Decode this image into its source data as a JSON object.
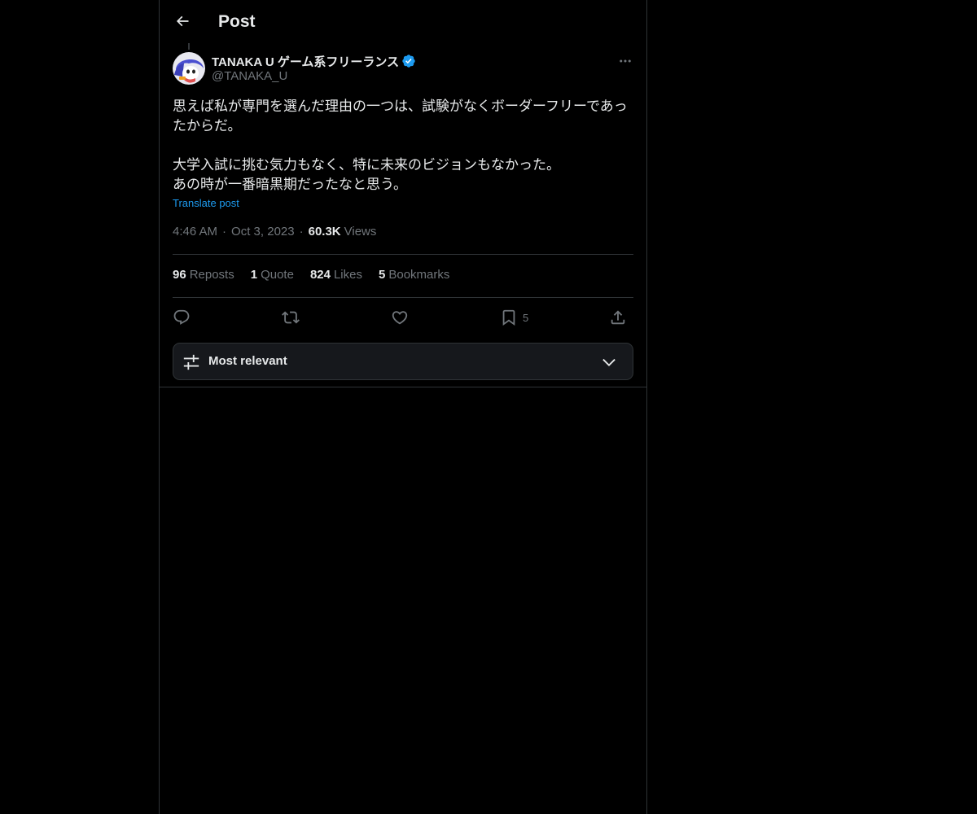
{
  "header": {
    "title": "Post"
  },
  "post": {
    "author": {
      "display_name": "TANAKA U ゲーム系フリーランス",
      "handle": "@TANAKA_U",
      "verified": true
    },
    "text": {
      "line1": "思えば私が専門を選んだ理由の一つは、試験がなくボーダーフリーであったからだ。",
      "line2": "大学入試に挑む気力もなく、特に未来のビジョンもなかった。",
      "line3": "あの時が一番暗黒期だったなと思う。"
    },
    "translate_label": "Translate post",
    "time": "4:46 AM",
    "date": "Oct 3, 2023",
    "views_count": "60.3K",
    "views_label": "Views",
    "separator": "·"
  },
  "stats": {
    "reposts_count": "96",
    "reposts_label": "Reposts",
    "quotes_count": "1",
    "quotes_label": "Quote",
    "likes_count": "824",
    "likes_label": "Likes",
    "bookmarks_count": "5",
    "bookmarks_label": "Bookmarks"
  },
  "actions": {
    "bookmark_count": "5"
  },
  "sort": {
    "label": "Most relevant"
  },
  "colors": {
    "accent": "#1d9bf0",
    "background": "#000000",
    "border": "#2f3336",
    "muted_text": "#71767b",
    "text": "#e7e9ea"
  },
  "icons": [
    "back-arrow-icon",
    "verified-badge-icon",
    "more-icon",
    "reply-icon",
    "repost-icon",
    "like-icon",
    "bookmark-icon",
    "share-icon",
    "sort-sliders-icon",
    "chevron-down-icon"
  ]
}
